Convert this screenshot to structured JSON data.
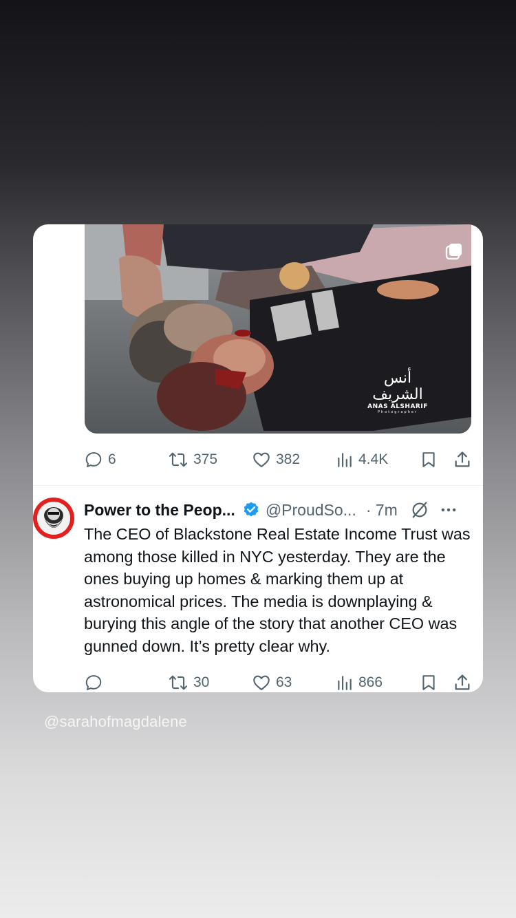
{
  "media": {
    "watermark_arabic": "أنس الشريف",
    "watermark_name": "ANAS ALSHARIF",
    "watermark_sub": "Photographer"
  },
  "first_post_actions": {
    "replies": "6",
    "reposts": "375",
    "likes": "382",
    "views": "4.4K"
  },
  "second_post": {
    "display_name": "Power to the Peop...",
    "handle": "@ProudSo...",
    "time": "· 7m",
    "text": "The CEO of Blackstone Real Estate Income Trust was among those killed in NYC yesterday. They are the ones buying up homes & marking them up at astronomical prices. The media is downplaying & burying this angle of the story that another CEO was gunned down. It’s pretty clear why.",
    "actions": {
      "replies": "",
      "reposts": "30",
      "likes": "63",
      "views": "866"
    }
  },
  "story_username": "@sarahofmagdalene",
  "colors": {
    "icon_gray": "#536471",
    "verified_blue": "#1d9bf0",
    "avatar_ring": "#e3201e",
    "text": "#0f1419"
  }
}
